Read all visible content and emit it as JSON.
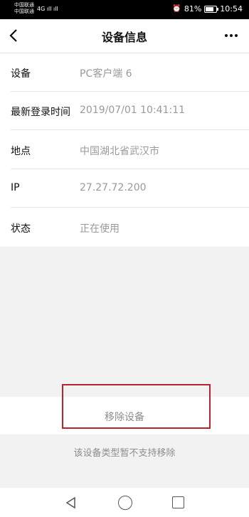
{
  "status_bar": {
    "carrier_1": "中国联通",
    "carrier_2": "中国联通",
    "signal_1": "4G ıll ıll",
    "battery_percent": "81%",
    "time": "10:54"
  },
  "header": {
    "back_icon": "chevron-left-icon",
    "title": "设备信息",
    "more_icon": "more-dots-icon"
  },
  "device_info": {
    "rows": [
      {
        "label": "设备",
        "value": "PC客户端 6"
      },
      {
        "label": "最新登录时间",
        "value": "2019/07/01 10:41:11"
      },
      {
        "label": "地点",
        "value": "中国湖北省武汉市"
      },
      {
        "label": "IP",
        "value": "27.27.72.200"
      },
      {
        "label": "状态",
        "value": "正在使用"
      }
    ]
  },
  "actions": {
    "remove_label": "移除设备",
    "note": "该设备类型暂不支持移除",
    "highlight_color": "#b8232d"
  },
  "nav_bar": {
    "back_icon": "triangle-back-icon",
    "home_icon": "circle-home-icon",
    "recents_icon": "square-recents-icon"
  }
}
